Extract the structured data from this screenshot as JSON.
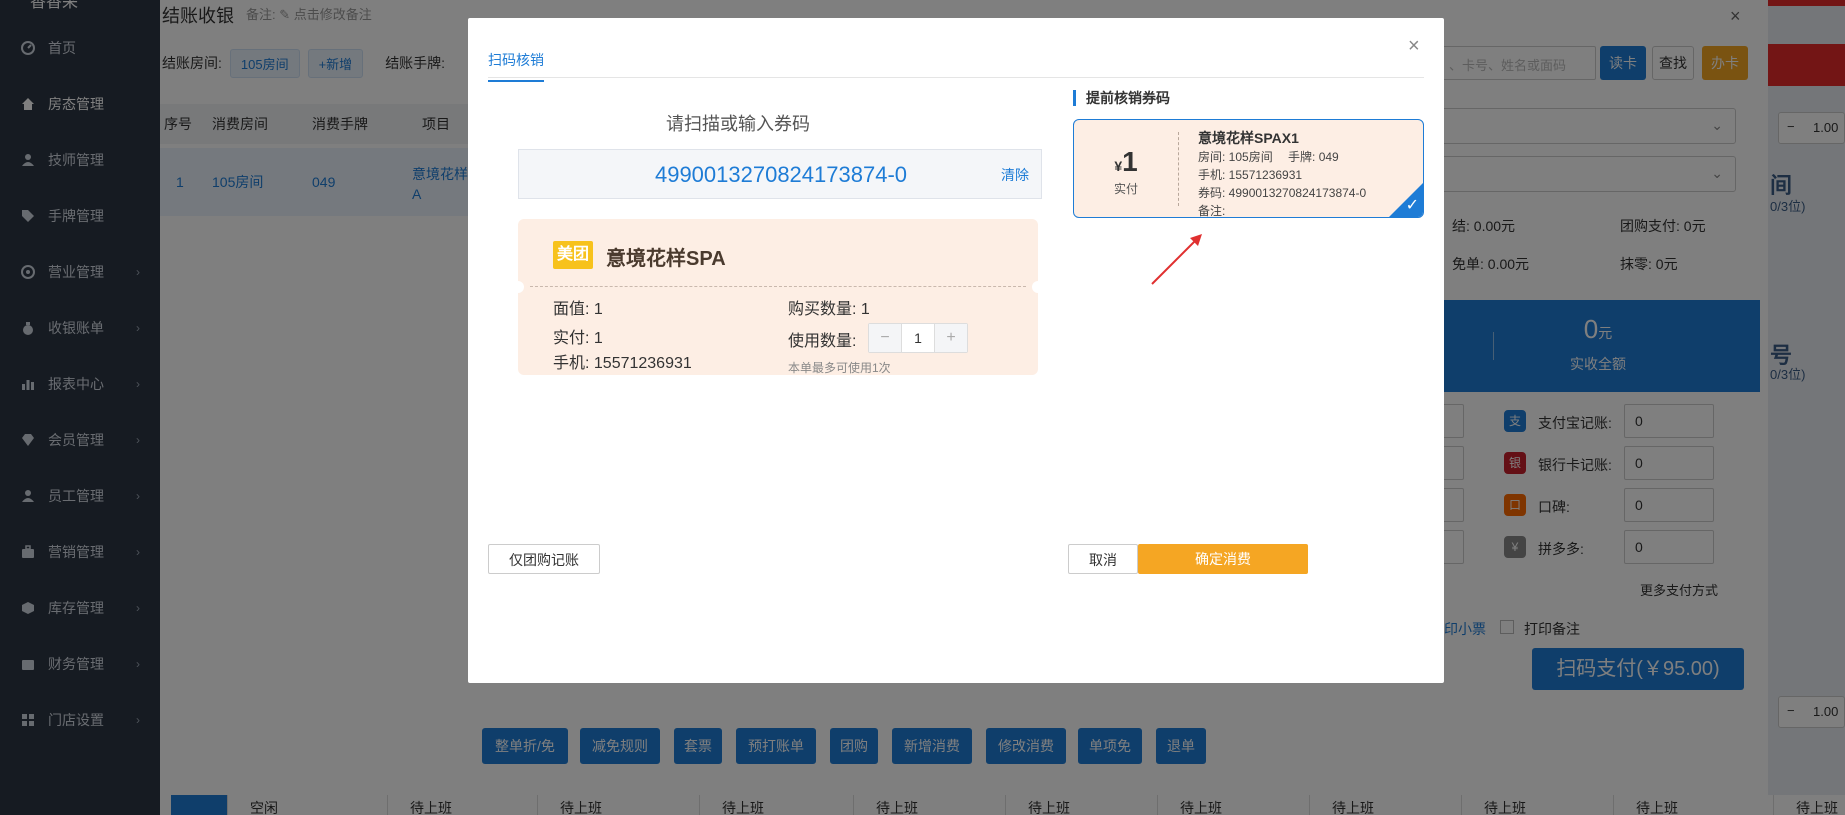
{
  "sidebar": {
    "brand": "香香采",
    "items": [
      {
        "label": "首页",
        "icon": "dashboard-icon",
        "chevron": false
      },
      {
        "label": "房态管理",
        "icon": "home-icon",
        "chevron": false
      },
      {
        "label": "技师管理",
        "icon": "user-icon",
        "chevron": false
      },
      {
        "label": "手牌管理",
        "icon": "tag-icon",
        "chevron": false
      },
      {
        "label": "营业管理",
        "icon": "target-icon",
        "chevron": true
      },
      {
        "label": "收银账单",
        "icon": "moneybag-icon",
        "chevron": true
      },
      {
        "label": "报表中心",
        "icon": "bar-chart-icon",
        "chevron": true
      },
      {
        "label": "会员管理",
        "icon": "diamond-icon",
        "chevron": true
      },
      {
        "label": "员工管理",
        "icon": "person-icon",
        "chevron": true
      },
      {
        "label": "营销管理",
        "icon": "briefcase-icon",
        "chevron": true
      },
      {
        "label": "库存管理",
        "icon": "box-icon",
        "chevron": true
      },
      {
        "label": "财务管理",
        "icon": "wallet-icon",
        "chevron": true
      },
      {
        "label": "门店设置",
        "icon": "grid-icon",
        "chevron": true
      }
    ]
  },
  "page": {
    "title": "结账收银",
    "note_label": "备注:",
    "note_link": "✎ 点击修改备注",
    "room_label": "结账房间:",
    "room_chip": "105房间",
    "add_chip": "+新增",
    "plate_label": "结账手牌:",
    "search_placeholder": "、卡号、姓名或面码",
    "read_card": "读卡",
    "find": "查找",
    "make_card": "办卡",
    "table": {
      "headers": [
        "序号",
        "消费房间",
        "消费手牌",
        "项目"
      ],
      "row": [
        "1",
        "105房间",
        "049",
        "意境花样",
        "A"
      ]
    },
    "right": {
      "room_title": "间",
      "room_sub": "0/3位)",
      "settled": "结: 0.00元",
      "group_pay": "团购支付: 0元",
      "free": "免单: 0.00元",
      "round": "抹零: 0元",
      "received_amount": "0",
      "received_unit": "元",
      "received_label": "实收全额",
      "room2_title": "号",
      "room2_sub": "0/3位)",
      "alipay_label": "支付宝记账:",
      "alipay_value": "0",
      "bank_label": "银行卡记账:",
      "bank_value": "0",
      "koubei_label": "口碑:",
      "koubei_value": "0",
      "pdd_label": "拼多多:",
      "pdd_value": "0",
      "more_pay": "更多支付方式",
      "print_ticket": "印小票",
      "print_note": "打印备注",
      "scan_pay": "扫码支付(￥95.00)",
      "qty1": "1.00",
      "qty2": "1.00",
      "minus": "−"
    },
    "actions": [
      "整单折/免",
      "减免规则",
      "套票",
      "预打账单",
      "团购",
      "新增消费",
      "修改消费",
      "单项免",
      "退单"
    ],
    "bottom_tabs": [
      "空闲",
      "待上班",
      "待上班",
      "待上班",
      "待上班",
      "待上班",
      "待上班",
      "待上班",
      "待上班",
      "待上班",
      "待上班"
    ]
  },
  "modal": {
    "tab": "扫码核销",
    "close": "×",
    "scan_title": "请扫描或输入券码",
    "code": "4990013270824173874-0",
    "clear": "清除",
    "ticket": {
      "badge": "美团",
      "name": "意境花样SPA",
      "face_value": "面值: 1",
      "paid": "实付: 1",
      "phone": "手机: 15571236931",
      "buy_qty": "购买数量: 1",
      "use_qty_label": "使用数量:",
      "use_qty": "1",
      "max_note": "本单最多可使用1次",
      "minus": "−",
      "plus": "+"
    },
    "pre": {
      "title": "提前核销券码",
      "yen": "¥",
      "amount": "1",
      "paid_label": "实付",
      "name": "意境花样SPAX1",
      "room": "房间: 105房间　 手牌: 049",
      "phone": "手机: 15571236931",
      "code": "券码: 4990013270824173874-0",
      "note": "备注:",
      "check": "✓"
    },
    "btn_only_group": "仅团购记账",
    "btn_cancel": "取消",
    "btn_confirm": "确定消费"
  }
}
